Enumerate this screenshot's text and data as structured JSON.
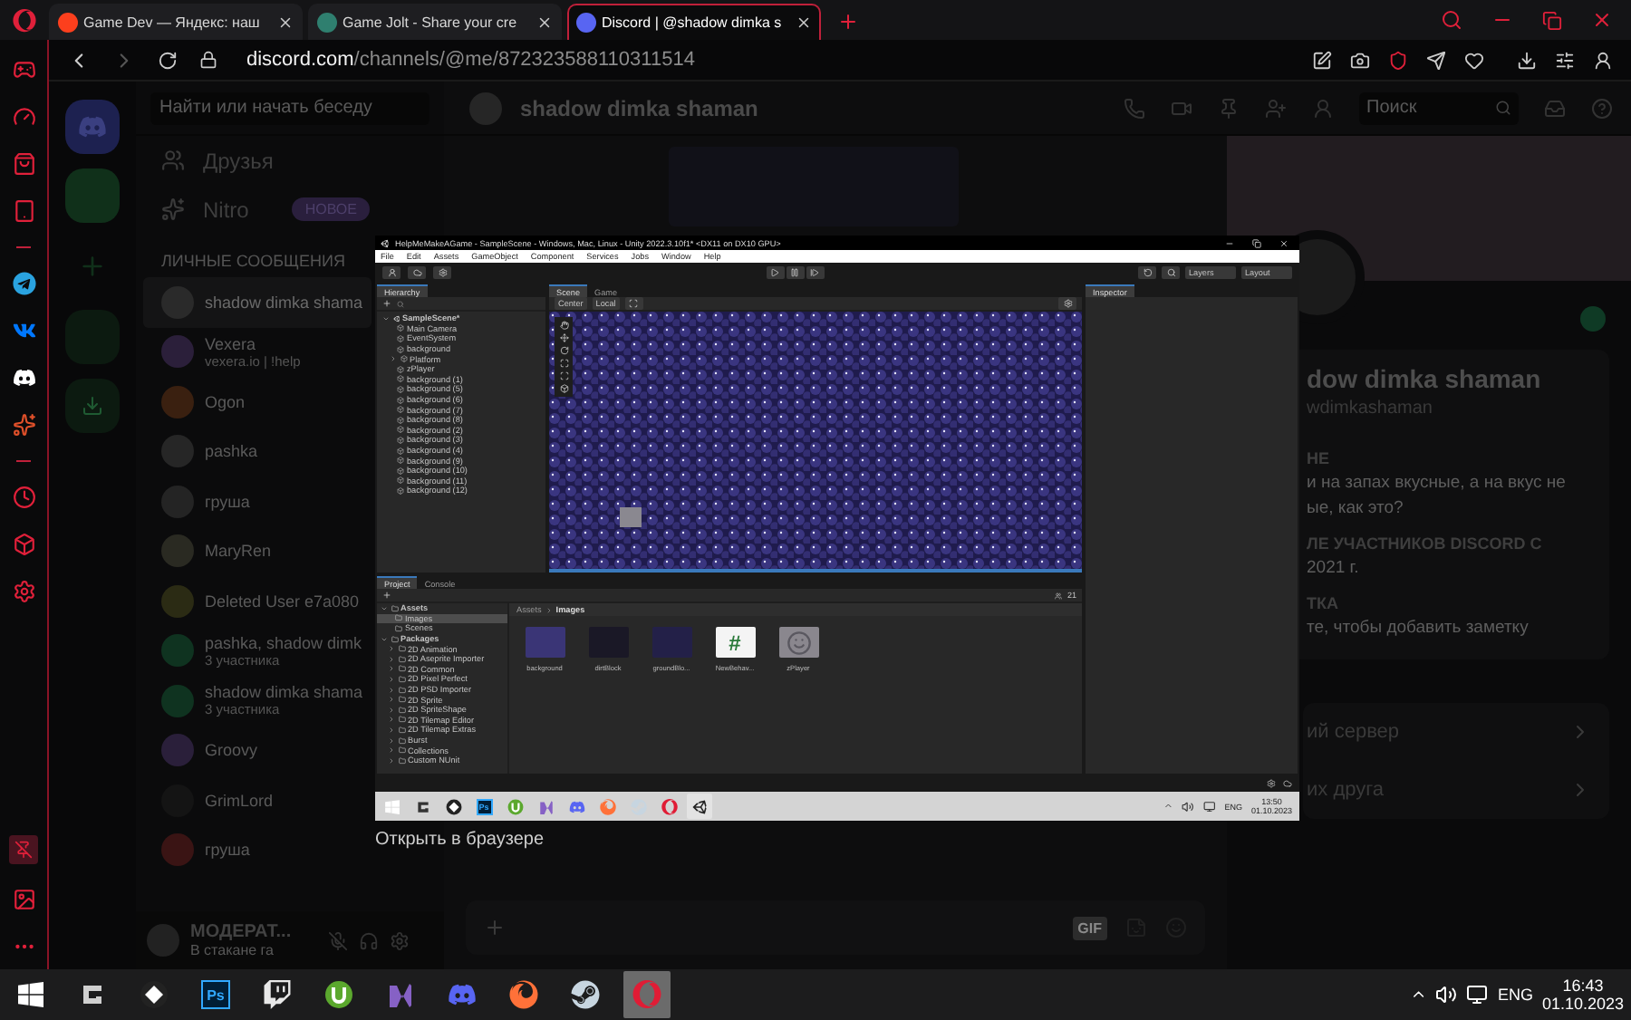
{
  "browser": {
    "tabs": [
      {
        "title": "Game Dev — Яндекс: наш",
        "selected": false
      },
      {
        "title": "Game Jolt - Share your cre",
        "selected": false
      },
      {
        "title": "Discord | @shadow dimka s",
        "selected": true
      }
    ],
    "url": {
      "domain": "discord.com",
      "path": "/channels/@me/872323588110311514"
    }
  },
  "discord": {
    "search_placeholder": "Найти или начать беседу",
    "nav": [
      {
        "label": "Друзья"
      },
      {
        "label": "Nitro",
        "badge": "НОВОЕ"
      }
    ],
    "dm_heading": "ЛИЧНЫЕ СООБЩЕНИЯ",
    "dms": [
      {
        "name": "shadow dimka shama",
        "selected": true
      },
      {
        "name": "Vexera",
        "subtitle": "vexera.io | !help",
        "selected": false
      },
      {
        "name": "Ogon",
        "selected": false
      },
      {
        "name": "pashka",
        "selected": false
      },
      {
        "name": "груша",
        "selected": false
      },
      {
        "name": "MaryRen",
        "selected": false
      },
      {
        "name": "Deleted User e7a080",
        "selected": false
      },
      {
        "name": "pashka, shadow dimk",
        "subtitle": "3 участника",
        "selected": false
      },
      {
        "name": "shadow dimka shama",
        "subtitle": "3 участника",
        "selected": false
      },
      {
        "name": "Groovy",
        "selected": false
      },
      {
        "name": "GrimLord",
        "selected": false
      },
      {
        "name": "груша",
        "selected": false
      }
    ],
    "user_panel": {
      "name": "МОДЕРАТ...",
      "status": "В стакане га"
    },
    "chat": {
      "title": "shadow dimka shaman",
      "search_placeholder": "Поиск",
      "gif_label": "GIF"
    },
    "profile": {
      "name": "dow dimka shaman",
      "username": "wdimkashaman",
      "sections": [
        {
          "heading": "НЕ",
          "lines": [
            "и на запах вкусные, а на вкус не",
            "ые, как это?"
          ]
        },
        {
          "heading": "ЛЕ УЧАСТНИКОВ DISCORD С",
          "lines": [
            "2021 г."
          ]
        },
        {
          "heading": "ТКА",
          "lines": [
            "те, чтобы добавить заметку"
          ]
        }
      ],
      "links": [
        "ий сервер",
        "их друга"
      ]
    }
  },
  "preview": {
    "caption": "Открыть в браузере",
    "unity": {
      "title": "HelpMeMakeAGame - SampleScene - Windows, Mac, Linux - Unity 2022.3.10f1* <DX11 on DX10 GPU>",
      "menu": [
        "File",
        "Edit",
        "Assets",
        "GameObject",
        "Component",
        "Services",
        "Jobs",
        "Window",
        "Help"
      ],
      "layers": "Layers",
      "layout": "Layout",
      "hierarchy": {
        "tab": "Hierarchy",
        "root": "SampleScene*",
        "children": [
          {
            "name": "Main Camera",
            "has_children": false
          },
          {
            "name": "EventSystem",
            "has_children": false
          },
          {
            "name": "background",
            "has_children": false
          },
          {
            "name": "Platform",
            "has_children": true
          },
          {
            "name": "zPlayer",
            "has_children": false
          },
          {
            "name": "background (1)",
            "has_children": false
          },
          {
            "name": "background (5)",
            "has_children": false
          },
          {
            "name": "background (6)",
            "has_children": false
          },
          {
            "name": "background (7)",
            "has_children": false
          },
          {
            "name": "background (8)",
            "has_children": false
          },
          {
            "name": "background (2)",
            "has_children": false
          },
          {
            "name": "background (3)",
            "has_children": false
          },
          {
            "name": "background (4)",
            "has_children": false
          },
          {
            "name": "background (9)",
            "has_children": false
          },
          {
            "name": "background (10)",
            "has_children": false
          },
          {
            "name": "background (11)",
            "has_children": false
          },
          {
            "name": "background (12)",
            "has_children": false
          }
        ]
      },
      "scene_tabs": [
        {
          "label": "Scene",
          "selected": true
        },
        {
          "label": "Game",
          "selected": false
        }
      ],
      "pivot": [
        "Center",
        "Local"
      ],
      "inspector_tab": "Inspector",
      "project_tabs": [
        {
          "label": "Project",
          "selected": true
        },
        {
          "label": "Console",
          "selected": false
        }
      ],
      "project_tree": [
        {
          "name": "Assets",
          "children": [
            {
              "name": "Images",
              "selected": true
            },
            {
              "name": "Scenes",
              "selected": false
            }
          ]
        },
        {
          "name": "Packages",
          "children": [
            {
              "name": "2D Animation",
              "selected": false
            },
            {
              "name": "2D Aseprite Importer",
              "selected": false
            },
            {
              "name": "2D Common",
              "selected": false
            },
            {
              "name": "2D Pixel Perfect",
              "selected": false
            },
            {
              "name": "2D PSD Importer",
              "selected": false
            },
            {
              "name": "2D Sprite",
              "selected": false
            },
            {
              "name": "2D SpriteShape",
              "selected": false
            },
            {
              "name": "2D Tilemap Editor",
              "selected": false
            },
            {
              "name": "2D Tilemap Extras",
              "selected": false
            },
            {
              "name": "Burst",
              "selected": false
            },
            {
              "name": "Collections",
              "selected": false
            },
            {
              "name": "Custom NUnit",
              "selected": false
            }
          ]
        }
      ],
      "breadcrumb": [
        "Assets",
        "Images"
      ],
      "asset_count": "21",
      "assets": [
        {
          "name": "background",
          "kind": "texture"
        },
        {
          "name": "dirtBlock",
          "kind": "dark"
        },
        {
          "name": "groundBlo...",
          "kind": "ground"
        },
        {
          "name": "NewBehav...",
          "kind": "script",
          "glyph": "#"
        },
        {
          "name": "zPlayer",
          "kind": "player"
        }
      ],
      "taskbar": {
        "apps": [
          {
            "kind": "start",
            "selected": false
          },
          {
            "kind": "ghub",
            "selected": false
          },
          {
            "kind": "diamond",
            "selected": false
          },
          {
            "kind": "photoshop",
            "label": "Ps",
            "selected": false
          },
          {
            "kind": "torrent",
            "selected": false
          },
          {
            "kind": "vs",
            "selected": false
          },
          {
            "kind": "discord",
            "selected": false
          },
          {
            "kind": "firefox",
            "selected": false
          },
          {
            "kind": "steam",
            "selected": false
          },
          {
            "kind": "opera",
            "selected": false
          },
          {
            "kind": "unity",
            "selected": true
          }
        ],
        "language": "ENG",
        "time": "13:50",
        "date": "01.10.2023"
      }
    }
  },
  "taskbar": {
    "apps": [
      {
        "kind": "start",
        "selected": false
      },
      {
        "kind": "ghub",
        "selected": false
      },
      {
        "kind": "diamond",
        "selected": false
      },
      {
        "kind": "photoshop",
        "label": "Ps",
        "selected": false
      },
      {
        "kind": "twitch",
        "selected": false
      },
      {
        "kind": "torrent",
        "selected": false
      },
      {
        "kind": "vs",
        "selected": false
      },
      {
        "kind": "discord",
        "selected": false
      },
      {
        "kind": "firefox",
        "selected": false
      },
      {
        "kind": "steam",
        "selected": false
      },
      {
        "kind": "opera",
        "selected": true
      }
    ],
    "language": "ENG",
    "time": "16:43",
    "date": "01.10.2023"
  }
}
